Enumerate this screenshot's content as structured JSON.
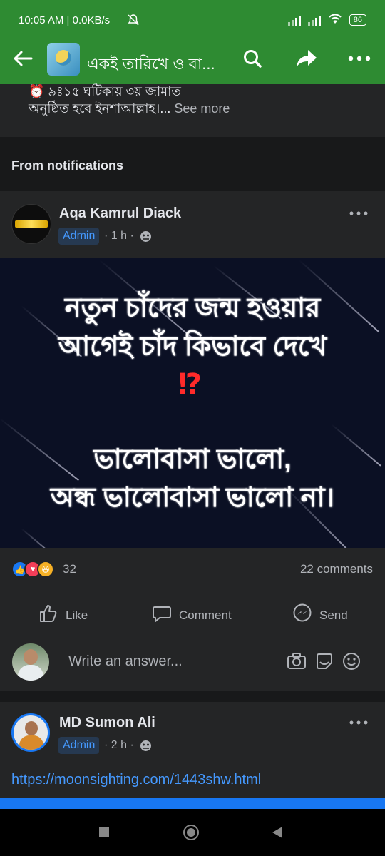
{
  "status_bar": {
    "time": "10:05 AM | 0.0KB/s",
    "battery": "86"
  },
  "app_bar": {
    "group_title": "একই তারিখে ও বা..."
  },
  "previous_post": {
    "line1": "⏰ ৯ঃ১৫ ঘটিকায় ৩য় জামাত",
    "line2": "অনুষ্ঠিত হবে ইনশাআল্লাহ।...",
    "see_more": " See more"
  },
  "section_header": "From notifications",
  "post1": {
    "author": "Aqa Kamrul Diack",
    "role_badge": "Admin",
    "time": "· 1 h ·",
    "image_text_line1": "নতুন চাঁদের জন্ম হওয়ার",
    "image_text_line2": "আগেই চাঁদ কিভাবে দেখে",
    "image_text_mark": "⁉",
    "image_text_line3": "ভালোবাসা ভালো,",
    "image_text_line4": "অন্ধ ভালোবাসা ভালো না।",
    "reaction_count": "32",
    "comments_count": "22 comments",
    "actions": {
      "like": "Like",
      "comment": "Comment",
      "send": "Send"
    },
    "answer_placeholder": "Write an answer..."
  },
  "post2": {
    "author": "MD Sumon Ali",
    "role_badge": "Admin",
    "time": "· 2 h ·",
    "link": "https://moonsighting.com/1443shw.html"
  },
  "colors": {
    "header_green": "#2e8b32",
    "feed_bg": "#242526",
    "link_blue": "#4599ff"
  }
}
